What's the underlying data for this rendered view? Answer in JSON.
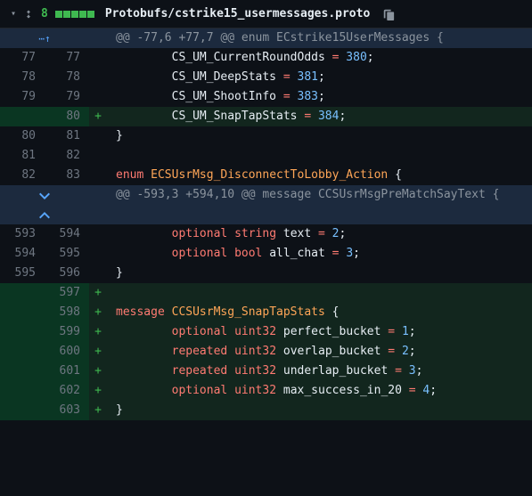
{
  "header": {
    "add_count": "8",
    "filename": "Protobufs/cstrike15_usermessages.proto"
  },
  "hunks": [
    {
      "header": "@@ -77,6 +77,7 @@ enum ECstrike15UserMessages {",
      "lines": [
        {
          "old": "77",
          "new": "77",
          "marker": "",
          "type": "context",
          "tokens": [
            {
              "t": "        CS_UM_CurrentRoundOdds ",
              "c": "kw-white"
            },
            {
              "t": "=",
              "c": "kw-red"
            },
            {
              "t": " ",
              "c": ""
            },
            {
              "t": "380",
              "c": "kw-blue"
            },
            {
              "t": ";",
              "c": "kw-white"
            }
          ]
        },
        {
          "old": "78",
          "new": "78",
          "marker": "",
          "type": "context",
          "tokens": [
            {
              "t": "        CS_UM_DeepStats ",
              "c": "kw-white"
            },
            {
              "t": "=",
              "c": "kw-red"
            },
            {
              "t": " ",
              "c": ""
            },
            {
              "t": "381",
              "c": "kw-blue"
            },
            {
              "t": ";",
              "c": "kw-white"
            }
          ]
        },
        {
          "old": "79",
          "new": "79",
          "marker": "",
          "type": "context",
          "tokens": [
            {
              "t": "        CS_UM_ShootInfo ",
              "c": "kw-white"
            },
            {
              "t": "=",
              "c": "kw-red"
            },
            {
              "t": " ",
              "c": ""
            },
            {
              "t": "383",
              "c": "kw-blue"
            },
            {
              "t": ";",
              "c": "kw-white"
            }
          ]
        },
        {
          "old": "",
          "new": "80",
          "marker": "+",
          "type": "addition",
          "tokens": [
            {
              "t": "        CS_UM_SnapTapStats ",
              "c": "kw-white"
            },
            {
              "t": "=",
              "c": "kw-red"
            },
            {
              "t": " ",
              "c": ""
            },
            {
              "t": "384",
              "c": "kw-blue"
            },
            {
              "t": ";",
              "c": "kw-white"
            }
          ]
        },
        {
          "old": "80",
          "new": "81",
          "marker": "",
          "type": "context",
          "tokens": [
            {
              "t": "}",
              "c": "kw-white"
            }
          ]
        },
        {
          "old": "81",
          "new": "82",
          "marker": "",
          "type": "context",
          "tokens": [
            {
              "t": "",
              "c": ""
            }
          ]
        },
        {
          "old": "82",
          "new": "83",
          "marker": "",
          "type": "context",
          "tokens": [
            {
              "t": "enum",
              "c": "kw-red"
            },
            {
              "t": " ",
              "c": ""
            },
            {
              "t": "ECSUsrMsg_DisconnectToLobby_Action",
              "c": "kw-orange"
            },
            {
              "t": " {",
              "c": "kw-white"
            }
          ]
        }
      ]
    },
    {
      "header": "@@ -593,3 +594,10 @@ message CCSUsrMsgPreMatchSayText {",
      "lines": [
        {
          "old": "593",
          "new": "594",
          "marker": "",
          "type": "context",
          "tokens": [
            {
              "t": "        ",
              "c": ""
            },
            {
              "t": "optional",
              "c": "kw-red"
            },
            {
              "t": " ",
              "c": ""
            },
            {
              "t": "string",
              "c": "kw-red"
            },
            {
              "t": " text ",
              "c": "kw-white"
            },
            {
              "t": "=",
              "c": "kw-red"
            },
            {
              "t": " ",
              "c": ""
            },
            {
              "t": "2",
              "c": "kw-blue"
            },
            {
              "t": ";",
              "c": "kw-white"
            }
          ]
        },
        {
          "old": "594",
          "new": "595",
          "marker": "",
          "type": "context",
          "tokens": [
            {
              "t": "        ",
              "c": ""
            },
            {
              "t": "optional",
              "c": "kw-red"
            },
            {
              "t": " ",
              "c": ""
            },
            {
              "t": "bool",
              "c": "kw-red"
            },
            {
              "t": " all_chat ",
              "c": "kw-white"
            },
            {
              "t": "=",
              "c": "kw-red"
            },
            {
              "t": " ",
              "c": ""
            },
            {
              "t": "3",
              "c": "kw-blue"
            },
            {
              "t": ";",
              "c": "kw-white"
            }
          ]
        },
        {
          "old": "595",
          "new": "596",
          "marker": "",
          "type": "context",
          "tokens": [
            {
              "t": "}",
              "c": "kw-white"
            }
          ]
        },
        {
          "old": "",
          "new": "597",
          "marker": "+",
          "type": "addition",
          "tokens": [
            {
              "t": "",
              "c": ""
            }
          ]
        },
        {
          "old": "",
          "new": "598",
          "marker": "+",
          "type": "addition",
          "tokens": [
            {
              "t": "message",
              "c": "kw-red"
            },
            {
              "t": " ",
              "c": ""
            },
            {
              "t": "CCSUsrMsg_SnapTapStats",
              "c": "kw-orange"
            },
            {
              "t": " {",
              "c": "kw-white"
            }
          ]
        },
        {
          "old": "",
          "new": "599",
          "marker": "+",
          "type": "addition",
          "tokens": [
            {
              "t": "        ",
              "c": ""
            },
            {
              "t": "optional",
              "c": "kw-red"
            },
            {
              "t": " ",
              "c": ""
            },
            {
              "t": "uint32",
              "c": "kw-red"
            },
            {
              "t": " perfect_bucket ",
              "c": "kw-white"
            },
            {
              "t": "=",
              "c": "kw-red"
            },
            {
              "t": " ",
              "c": ""
            },
            {
              "t": "1",
              "c": "kw-blue"
            },
            {
              "t": ";",
              "c": "kw-white"
            }
          ]
        },
        {
          "old": "",
          "new": "600",
          "marker": "+",
          "type": "addition",
          "tokens": [
            {
              "t": "        ",
              "c": ""
            },
            {
              "t": "repeated",
              "c": "kw-red"
            },
            {
              "t": " ",
              "c": ""
            },
            {
              "t": "uint32",
              "c": "kw-red"
            },
            {
              "t": " overlap_bucket ",
              "c": "kw-white"
            },
            {
              "t": "=",
              "c": "kw-red"
            },
            {
              "t": " ",
              "c": ""
            },
            {
              "t": "2",
              "c": "kw-blue"
            },
            {
              "t": ";",
              "c": "kw-white"
            }
          ]
        },
        {
          "old": "",
          "new": "601",
          "marker": "+",
          "type": "addition",
          "tokens": [
            {
              "t": "        ",
              "c": ""
            },
            {
              "t": "repeated",
              "c": "kw-red"
            },
            {
              "t": " ",
              "c": ""
            },
            {
              "t": "uint32",
              "c": "kw-red"
            },
            {
              "t": " underlap_bucket ",
              "c": "kw-white"
            },
            {
              "t": "=",
              "c": "kw-red"
            },
            {
              "t": " ",
              "c": ""
            },
            {
              "t": "3",
              "c": "kw-blue"
            },
            {
              "t": ";",
              "c": "kw-white"
            }
          ]
        },
        {
          "old": "",
          "new": "602",
          "marker": "+",
          "type": "addition",
          "tokens": [
            {
              "t": "        ",
              "c": ""
            },
            {
              "t": "optional",
              "c": "kw-red"
            },
            {
              "t": " ",
              "c": ""
            },
            {
              "t": "uint32",
              "c": "kw-red"
            },
            {
              "t": " max_success_in_20 ",
              "c": "kw-white"
            },
            {
              "t": "=",
              "c": "kw-red"
            },
            {
              "t": " ",
              "c": ""
            },
            {
              "t": "4",
              "c": "kw-blue"
            },
            {
              "t": ";",
              "c": "kw-white"
            }
          ]
        },
        {
          "old": "",
          "new": "603",
          "marker": "+",
          "type": "addition",
          "tokens": [
            {
              "t": "}",
              "c": "kw-white"
            }
          ]
        }
      ]
    }
  ]
}
